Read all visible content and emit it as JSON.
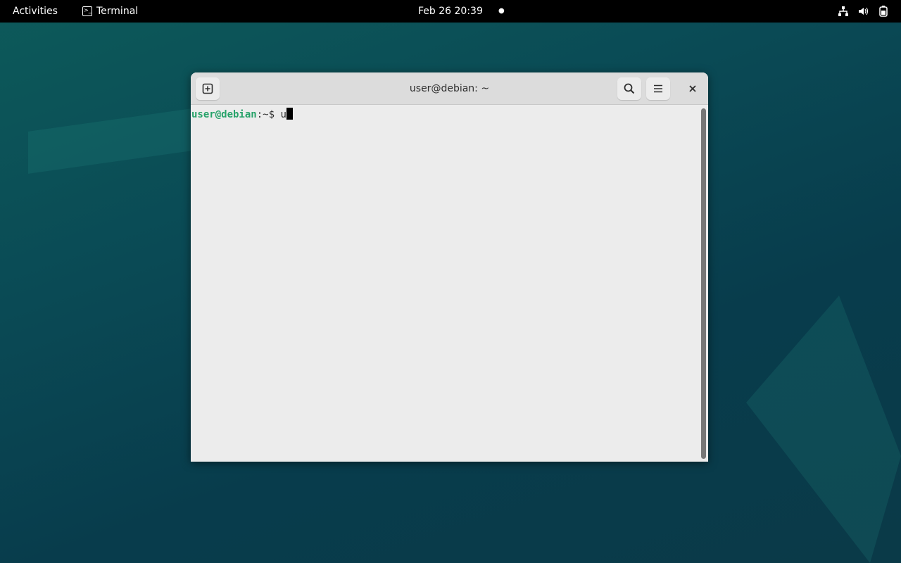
{
  "topbar": {
    "activities": "Activities",
    "app_name": "Terminal",
    "clock": "Feb 26  20:39"
  },
  "window": {
    "title": "user@debian: ~"
  },
  "terminal": {
    "prompt_user": "user@debian",
    "prompt_path": ":~$ ",
    "input": "u"
  }
}
